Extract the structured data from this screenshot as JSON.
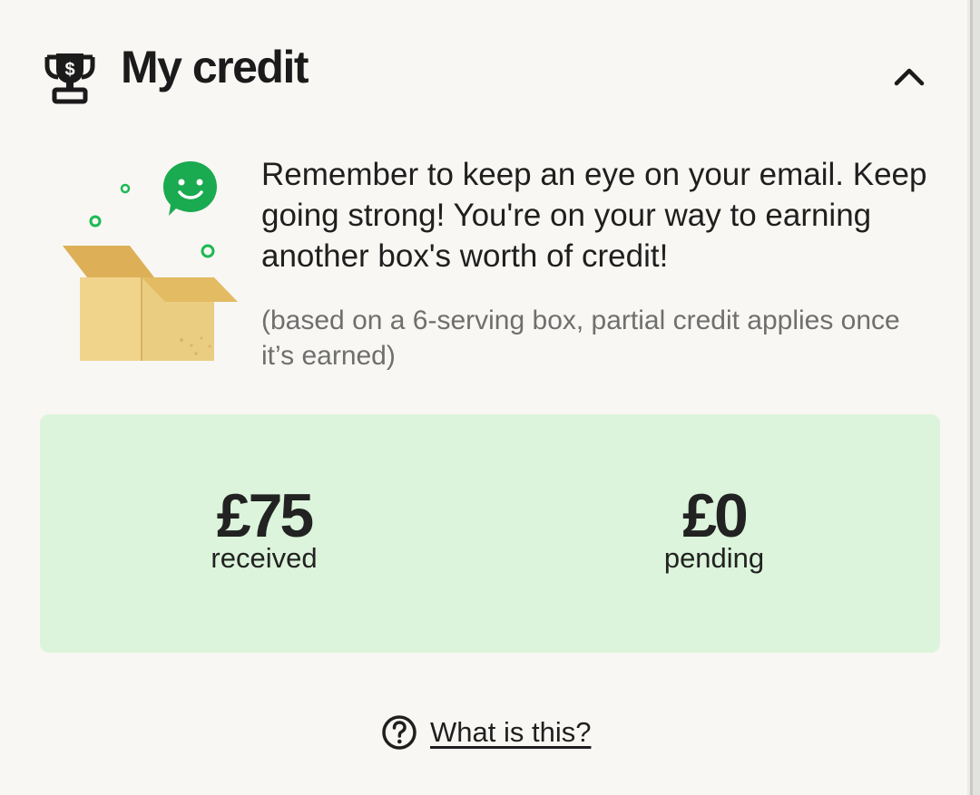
{
  "header": {
    "title": "My credit",
    "trophy_icon": "trophy-dollar-icon",
    "toggle_icon": "chevron-up-icon"
  },
  "illustration": {
    "icon": "open-box-smiley-illustration"
  },
  "message": {
    "text": "Remember to keep an eye on your email. Keep going strong! You're on your way to earning another box's worth of credit!",
    "note": "(based on a 6-serving box, partial credit applies once it’s earned)"
  },
  "credit": {
    "received": {
      "amount": "£75",
      "label": "received"
    },
    "pending": {
      "amount": "£0",
      "label": "pending"
    }
  },
  "help": {
    "icon": "question-circle-icon",
    "label": "What is this?"
  },
  "colors": {
    "background": "#f8f7f3",
    "panel": "#dcf4db",
    "accent_green": "#1db954",
    "box": "#eccd83",
    "text": "#1f1f1f",
    "muted_text": "#6f6f6f"
  }
}
